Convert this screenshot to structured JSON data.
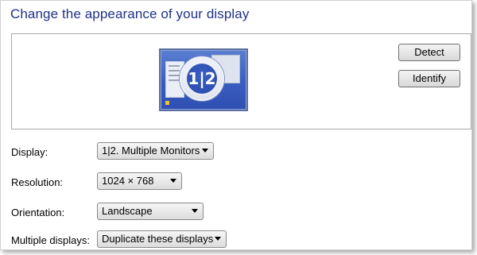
{
  "title": "Change the appearance of your display",
  "monitor": {
    "badge_text": "1|2"
  },
  "buttons": {
    "detect": "Detect",
    "identify": "Identify"
  },
  "settings": {
    "display": {
      "label": "Display:",
      "value": "1|2. Multiple Monitors"
    },
    "resolution": {
      "label": "Resolution:",
      "value": "1024 × 768"
    },
    "orientation": {
      "label": "Orientation:",
      "value": "Landscape"
    },
    "multiple": {
      "label": "Multiple displays:",
      "value": "Duplicate these displays"
    }
  }
}
